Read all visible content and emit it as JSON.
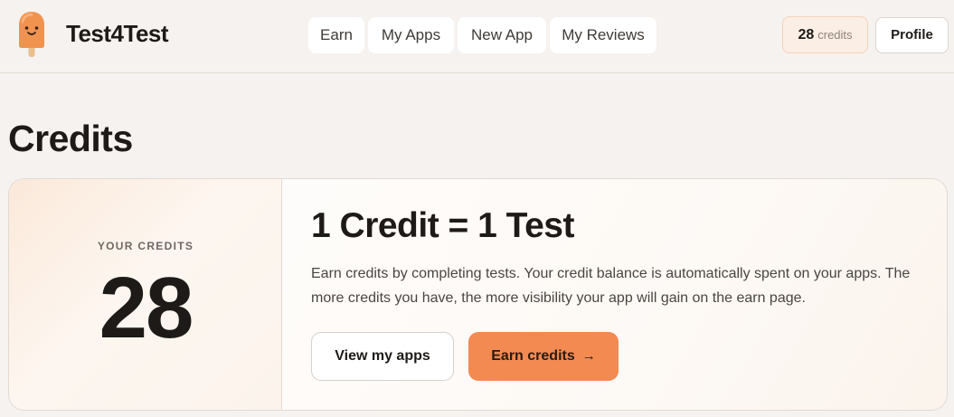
{
  "header": {
    "brand": "Test4Test",
    "nav": [
      {
        "label": "Earn"
      },
      {
        "label": "My Apps"
      },
      {
        "label": "New App"
      },
      {
        "label": "My Reviews"
      }
    ],
    "credits_count": "28",
    "credits_label": "credits",
    "profile_label": "Profile"
  },
  "page": {
    "title": "Credits"
  },
  "card": {
    "your_credits_label": "YOUR CREDITS",
    "credits_value": "28",
    "headline": "1 Credit = 1 Test",
    "description": "Earn credits by completing tests. Your credit balance is automatically spent on your apps. The more credits you have, the more visibility your app will gain on the earn page.",
    "view_apps_label": "View my apps",
    "earn_credits_label": "Earn credits",
    "earn_arrow": "→"
  },
  "colors": {
    "accent": "#f28a52",
    "background": "#f6f2ef",
    "text": "#1d1a17"
  },
  "icons": {
    "logo": "popsicle-logo-icon",
    "arrow": "arrow-right-icon"
  }
}
